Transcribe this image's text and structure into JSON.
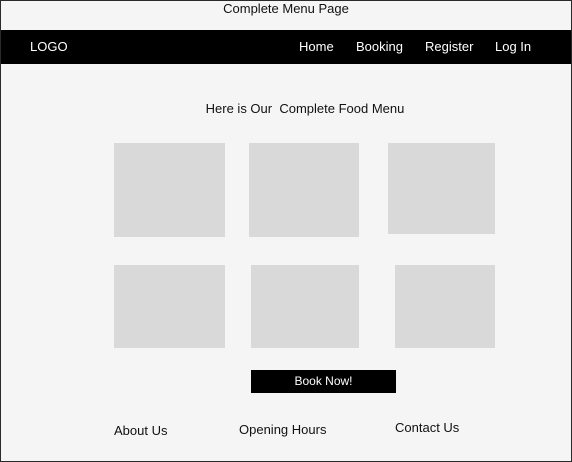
{
  "page": {
    "title": "Complete Menu Page"
  },
  "navbar": {
    "logo": "LOGO",
    "links": [
      {
        "label": "Home"
      },
      {
        "label": "Booking"
      },
      {
        "label": "Register"
      },
      {
        "label": "Log In"
      }
    ]
  },
  "main": {
    "heading": "Here is Our  Complete Food Menu",
    "menu_items_count": 6,
    "book_button_label": "Book Now!"
  },
  "footer": {
    "links": [
      {
        "label": "About Us"
      },
      {
        "label": "Opening Hours"
      },
      {
        "label": "Contact Us"
      }
    ]
  },
  "colors": {
    "background": "#f5f5f5",
    "navbar": "#000000",
    "nav_text": "#ffffff",
    "placeholder": "#d9d9d9",
    "button": "#000000",
    "button_text": "#ffffff",
    "text": "#111111"
  }
}
